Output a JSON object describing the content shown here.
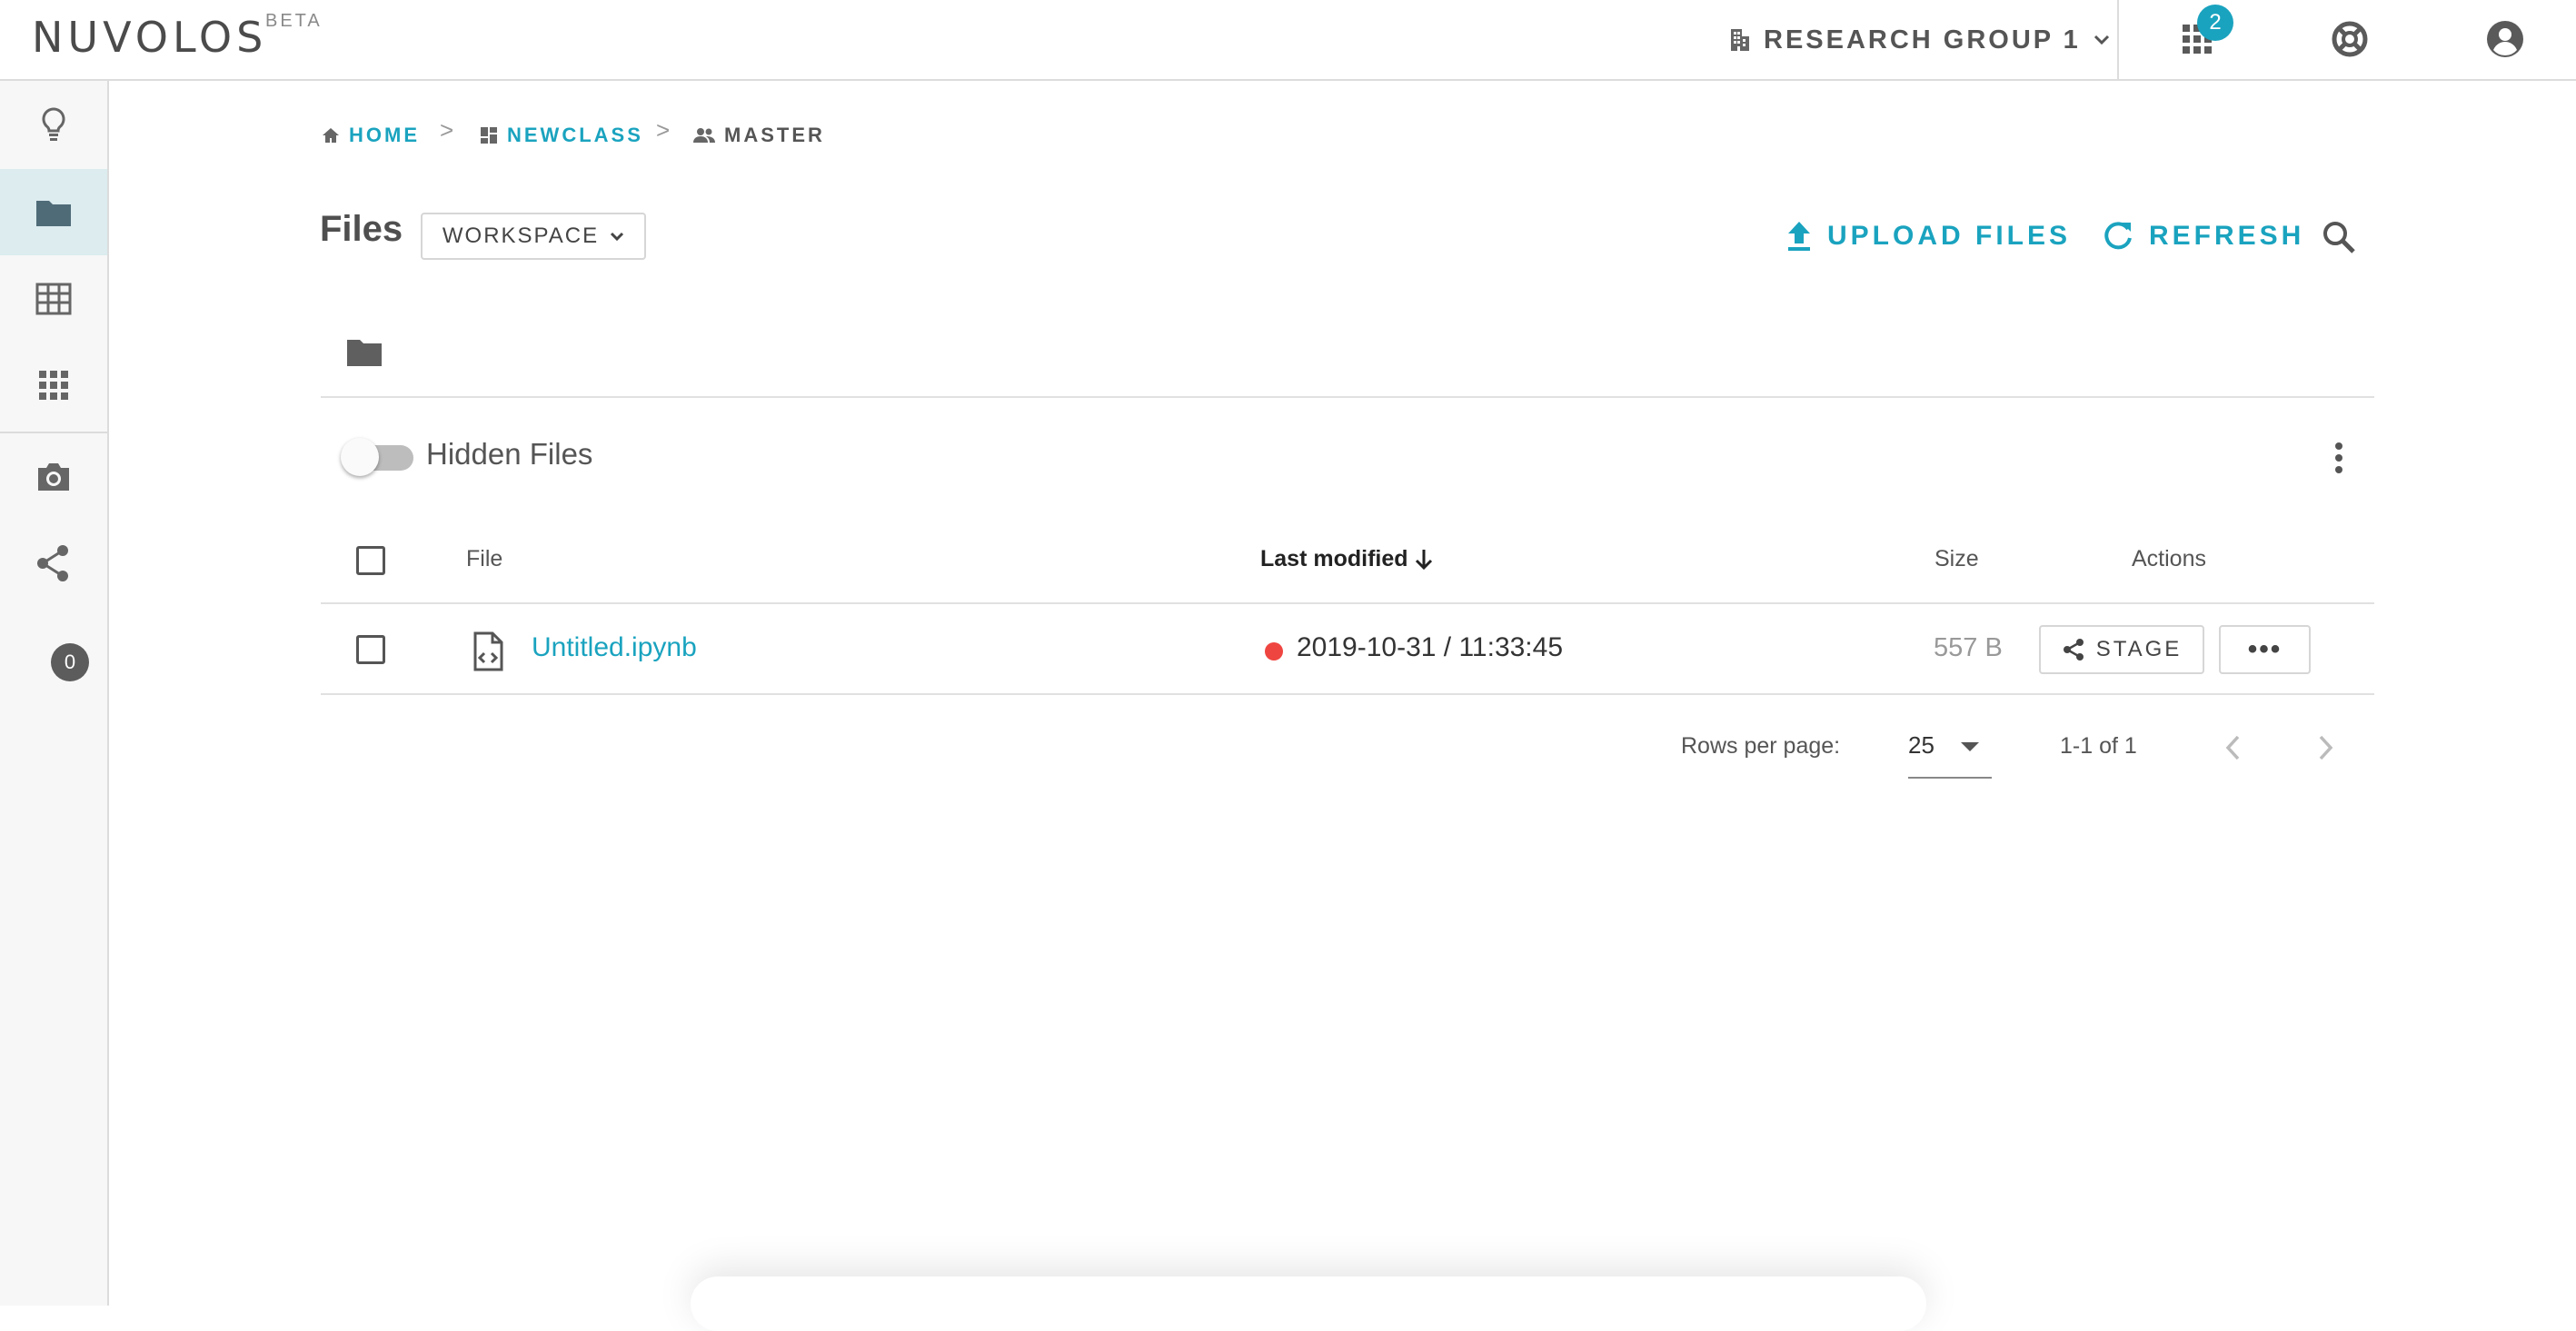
{
  "app": {
    "logo": "NUVOLOS",
    "beta": "BETA"
  },
  "topbar": {
    "org_name": "RESEARCH GROUP 1",
    "apps_badge": "2"
  },
  "sidebar": {
    "share_count": "0"
  },
  "breadcrumb": {
    "home": "HOME",
    "class": "NEWCLASS",
    "instance": "MASTER",
    "separator": ">"
  },
  "page": {
    "title": "Files",
    "workspace_label": "WORKSPACE"
  },
  "actions": {
    "upload": "UPLOAD FILES",
    "refresh": "REFRESH"
  },
  "hidden_files": {
    "label": "Hidden Files",
    "enabled": false
  },
  "table": {
    "headers": {
      "file": "File",
      "last_modified": "Last modified",
      "size": "Size",
      "actions": "Actions"
    },
    "rows": [
      {
        "name": "Untitled.ipynb",
        "modified": "2019-10-31 / 11:33:45",
        "size": "557 B",
        "stage": "STAGE",
        "more": "•••",
        "status_color": "#ef4540"
      }
    ]
  },
  "pagination": {
    "rows_per_page_label": "Rows per page:",
    "rows_per_page": "25",
    "range": "1-1 of 1"
  },
  "colors": {
    "accent": "#1aa3bf",
    "sidebar_active": "#dcecef"
  }
}
